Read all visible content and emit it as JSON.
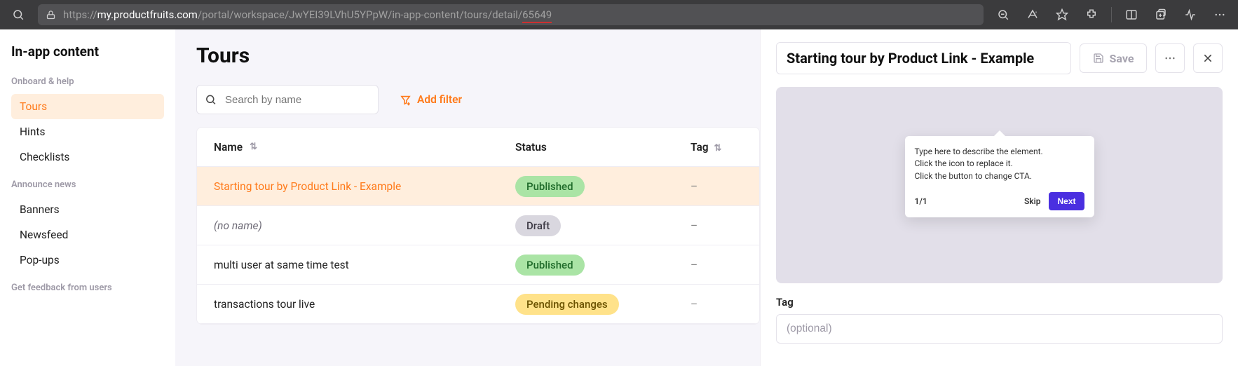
{
  "browser": {
    "url_domain": "my.productfruits.com",
    "url_path_before": "/portal/workspace/JwYEI39LVhU5YPpW/in-app-content/tours/detail/",
    "url_path_underlined": "65649"
  },
  "sidebar": {
    "title": "In-app content",
    "sections": [
      {
        "label": "Onboard & help",
        "items": [
          {
            "label": "Tours",
            "active": true
          },
          {
            "label": "Hints",
            "active": false
          },
          {
            "label": "Checklists",
            "active": false
          }
        ]
      },
      {
        "label": "Announce news",
        "items": [
          {
            "label": "Banners",
            "active": false
          },
          {
            "label": "Newsfeed",
            "active": false
          },
          {
            "label": "Pop-ups",
            "active": false
          }
        ]
      },
      {
        "label": "Get feedback from users",
        "items": []
      }
    ]
  },
  "main": {
    "page_title": "Tours",
    "search_placeholder": "Search by name",
    "add_filter_label": "Add filter",
    "columns": {
      "name": "Name",
      "status": "Status",
      "tag": "Tag"
    },
    "rows": [
      {
        "name": "Starting tour by Product Link - Example",
        "status": "Published",
        "status_class": "published",
        "tag": "–",
        "selected": true
      },
      {
        "name": "(no name)",
        "noname": true,
        "status": "Draft",
        "status_class": "draft",
        "tag": "–"
      },
      {
        "name": "multi user at same time test",
        "status": "Published",
        "status_class": "published",
        "tag": "–"
      },
      {
        "name": "transactions tour live",
        "status": "Pending changes",
        "status_class": "pending",
        "tag": "–"
      }
    ]
  },
  "right": {
    "title": "Starting tour by Product Link - Example",
    "save_label": "Save",
    "tooltip_text": "Type here to describe the element.\nClick the icon to replace it.\nClick the button to change CTA.",
    "tooltip_counter": "1/1",
    "skip_label": "Skip",
    "next_label": "Next",
    "tag_label": "Tag",
    "tag_placeholder": "(optional)"
  }
}
